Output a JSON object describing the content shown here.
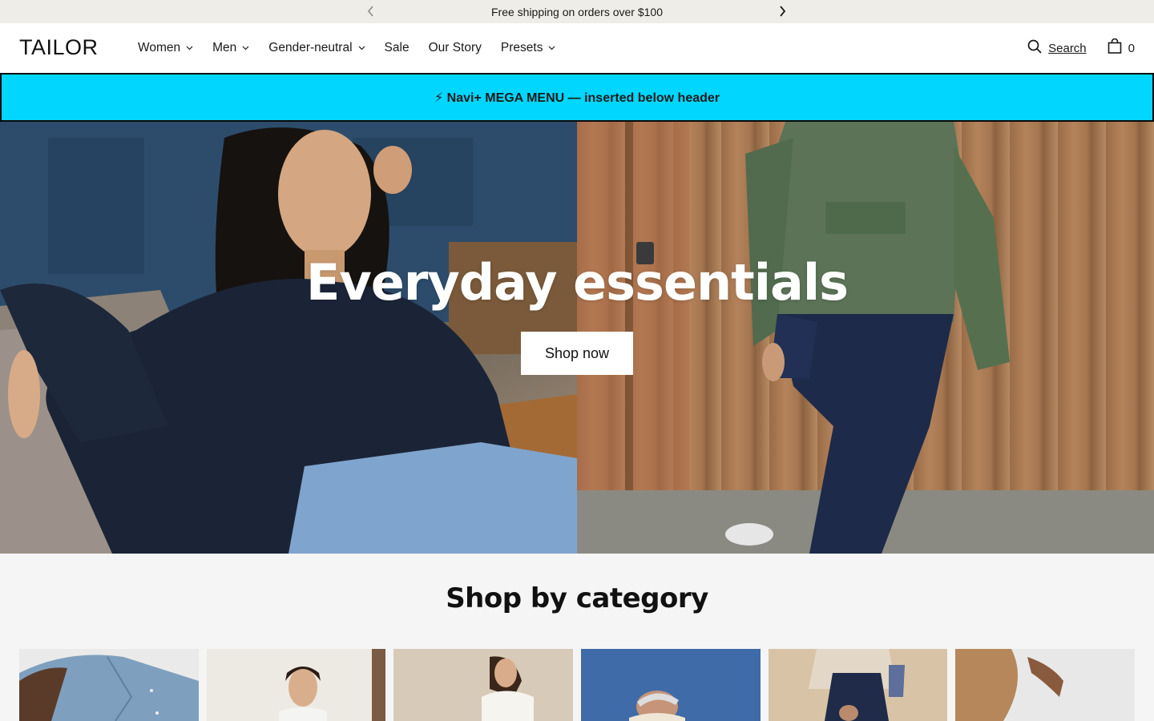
{
  "announcement": {
    "text": "Free shipping on orders over $100",
    "prev_icon": "chevron-left-icon",
    "next_icon": "chevron-right-icon"
  },
  "header": {
    "logo": "TAILOR",
    "nav": [
      {
        "label": "Women",
        "has_dropdown": true
      },
      {
        "label": "Men",
        "has_dropdown": true
      },
      {
        "label": "Gender-neutral",
        "has_dropdown": true
      },
      {
        "label": "Sale",
        "has_dropdown": false
      },
      {
        "label": "Our Story",
        "has_dropdown": false
      },
      {
        "label": "Presets",
        "has_dropdown": true
      }
    ],
    "search_label": "Search",
    "cart_count": "0"
  },
  "navi": {
    "text": "⚡ Navi+ MEGA MENU — inserted below header",
    "background": "#00d6ff"
  },
  "hero": {
    "title": "Everyday essentials",
    "button_label": "Shop now"
  },
  "category": {
    "title": "Shop by category",
    "cards": [
      {
        "name": "denim-shirt"
      },
      {
        "name": "woman-white-top"
      },
      {
        "name": "woman-tee"
      },
      {
        "name": "man-sky"
      },
      {
        "name": "fleece-jacket"
      },
      {
        "name": "khaki-pants"
      }
    ]
  },
  "colors": {
    "announcement_bg": "#efede7",
    "section_bg": "#f5f5f5",
    "text": "#1a1a1a"
  }
}
